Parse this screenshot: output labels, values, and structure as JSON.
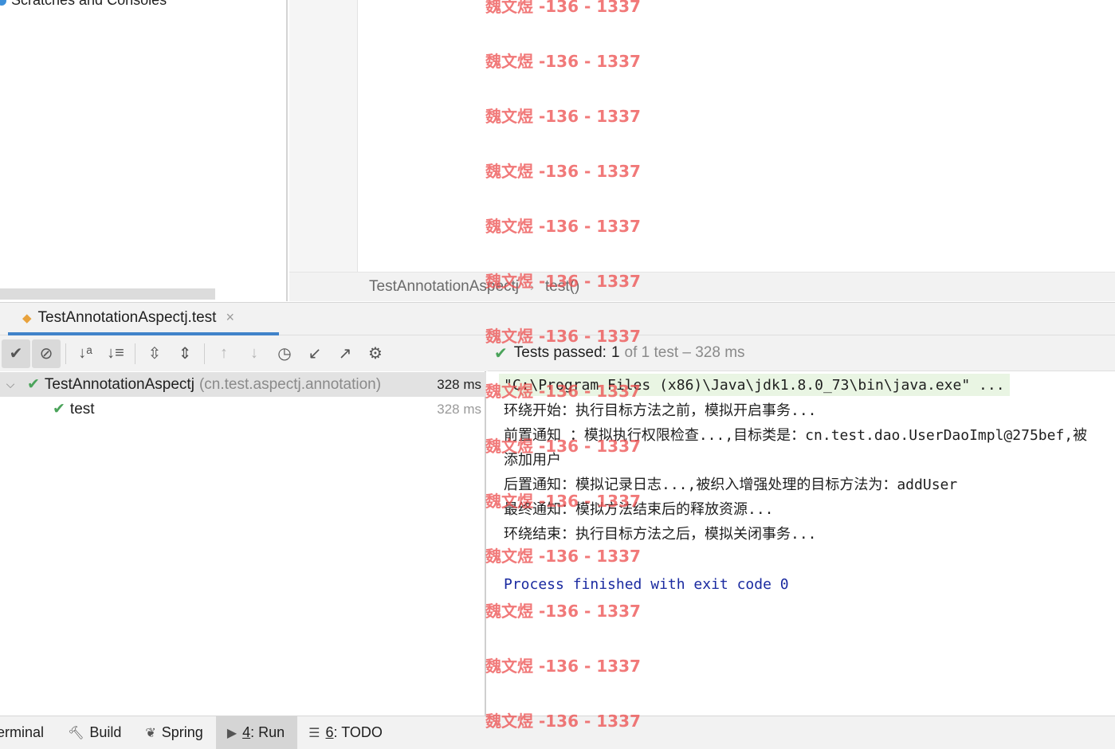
{
  "project_panel": {
    "scratches_label": "Scratches and Consoles"
  },
  "breadcrumb": {
    "class_name": "TestAnnotationAspectj",
    "separator": "›",
    "method": "test()"
  },
  "run_tab": {
    "label": "TestAnnotationAspectj.test",
    "close": "×"
  },
  "toolbar": {
    "buttons": [
      {
        "name": "show-passed",
        "glyph": "✔"
      },
      {
        "name": "show-ignored",
        "glyph": "⊘"
      },
      {
        "name": "sort-alpha",
        "glyph": "↓ᵃ"
      },
      {
        "name": "sort-duration",
        "glyph": "↓≡"
      },
      {
        "name": "expand-all",
        "glyph": "⇳"
      },
      {
        "name": "collapse-all",
        "glyph": "⇕"
      },
      {
        "name": "prev-failed",
        "glyph": "↑"
      },
      {
        "name": "next-failed",
        "glyph": "↓"
      },
      {
        "name": "history",
        "glyph": "◷"
      },
      {
        "name": "import-tests",
        "glyph": "↙"
      },
      {
        "name": "export-tests",
        "glyph": "↗"
      },
      {
        "name": "settings",
        "glyph": "⚙"
      }
    ]
  },
  "status": {
    "passed_label": "Tests passed:",
    "passed_count": "1",
    "suffix": "of 1 test – 328 ms"
  },
  "test_tree": {
    "suite": {
      "name": "TestAnnotationAspectj",
      "package": "(cn.test.aspectj.annotation)",
      "time": "328 ms"
    },
    "test": {
      "name": "test",
      "time": "328 ms"
    }
  },
  "console": {
    "command": "\"C:\\Program Files (x86)\\Java\\jdk1.8.0_73\\bin\\java.exe\" ...",
    "lines": [
      "环绕开始：执行目标方法之前，模拟开启事务...",
      "前置通知 ：模拟执行权限检查...,目标类是：cn.test.dao.UserDaoImpl@275bef,被",
      "添加用户",
      "后置通知：模拟记录日志...,被织入增强处理的目标方法为：addUser",
      "最终通知：模拟方法结束后的释放资源...",
      "环绕结束：执行目标方法之后，模拟关闭事务..."
    ],
    "exit": "Process finished with exit code 0"
  },
  "bottom_bar": {
    "items": [
      {
        "label": "erminal"
      },
      {
        "icon": "hammer-icon",
        "label": "Build"
      },
      {
        "icon": "spring-icon",
        "label": "Spring"
      },
      {
        "icon": "run-icon",
        "num": "4",
        "label": ": Run"
      },
      {
        "icon": "todo-icon",
        "num": "6",
        "label": ": TODO"
      }
    ]
  },
  "watermark": {
    "text": "魏文煜 -136 - 1337"
  },
  "colors": {
    "accent": "#4083c9",
    "pass_green": "#4aa35a",
    "exit_blue": "#1a2aa0",
    "watermark": "#ec4c4c"
  }
}
